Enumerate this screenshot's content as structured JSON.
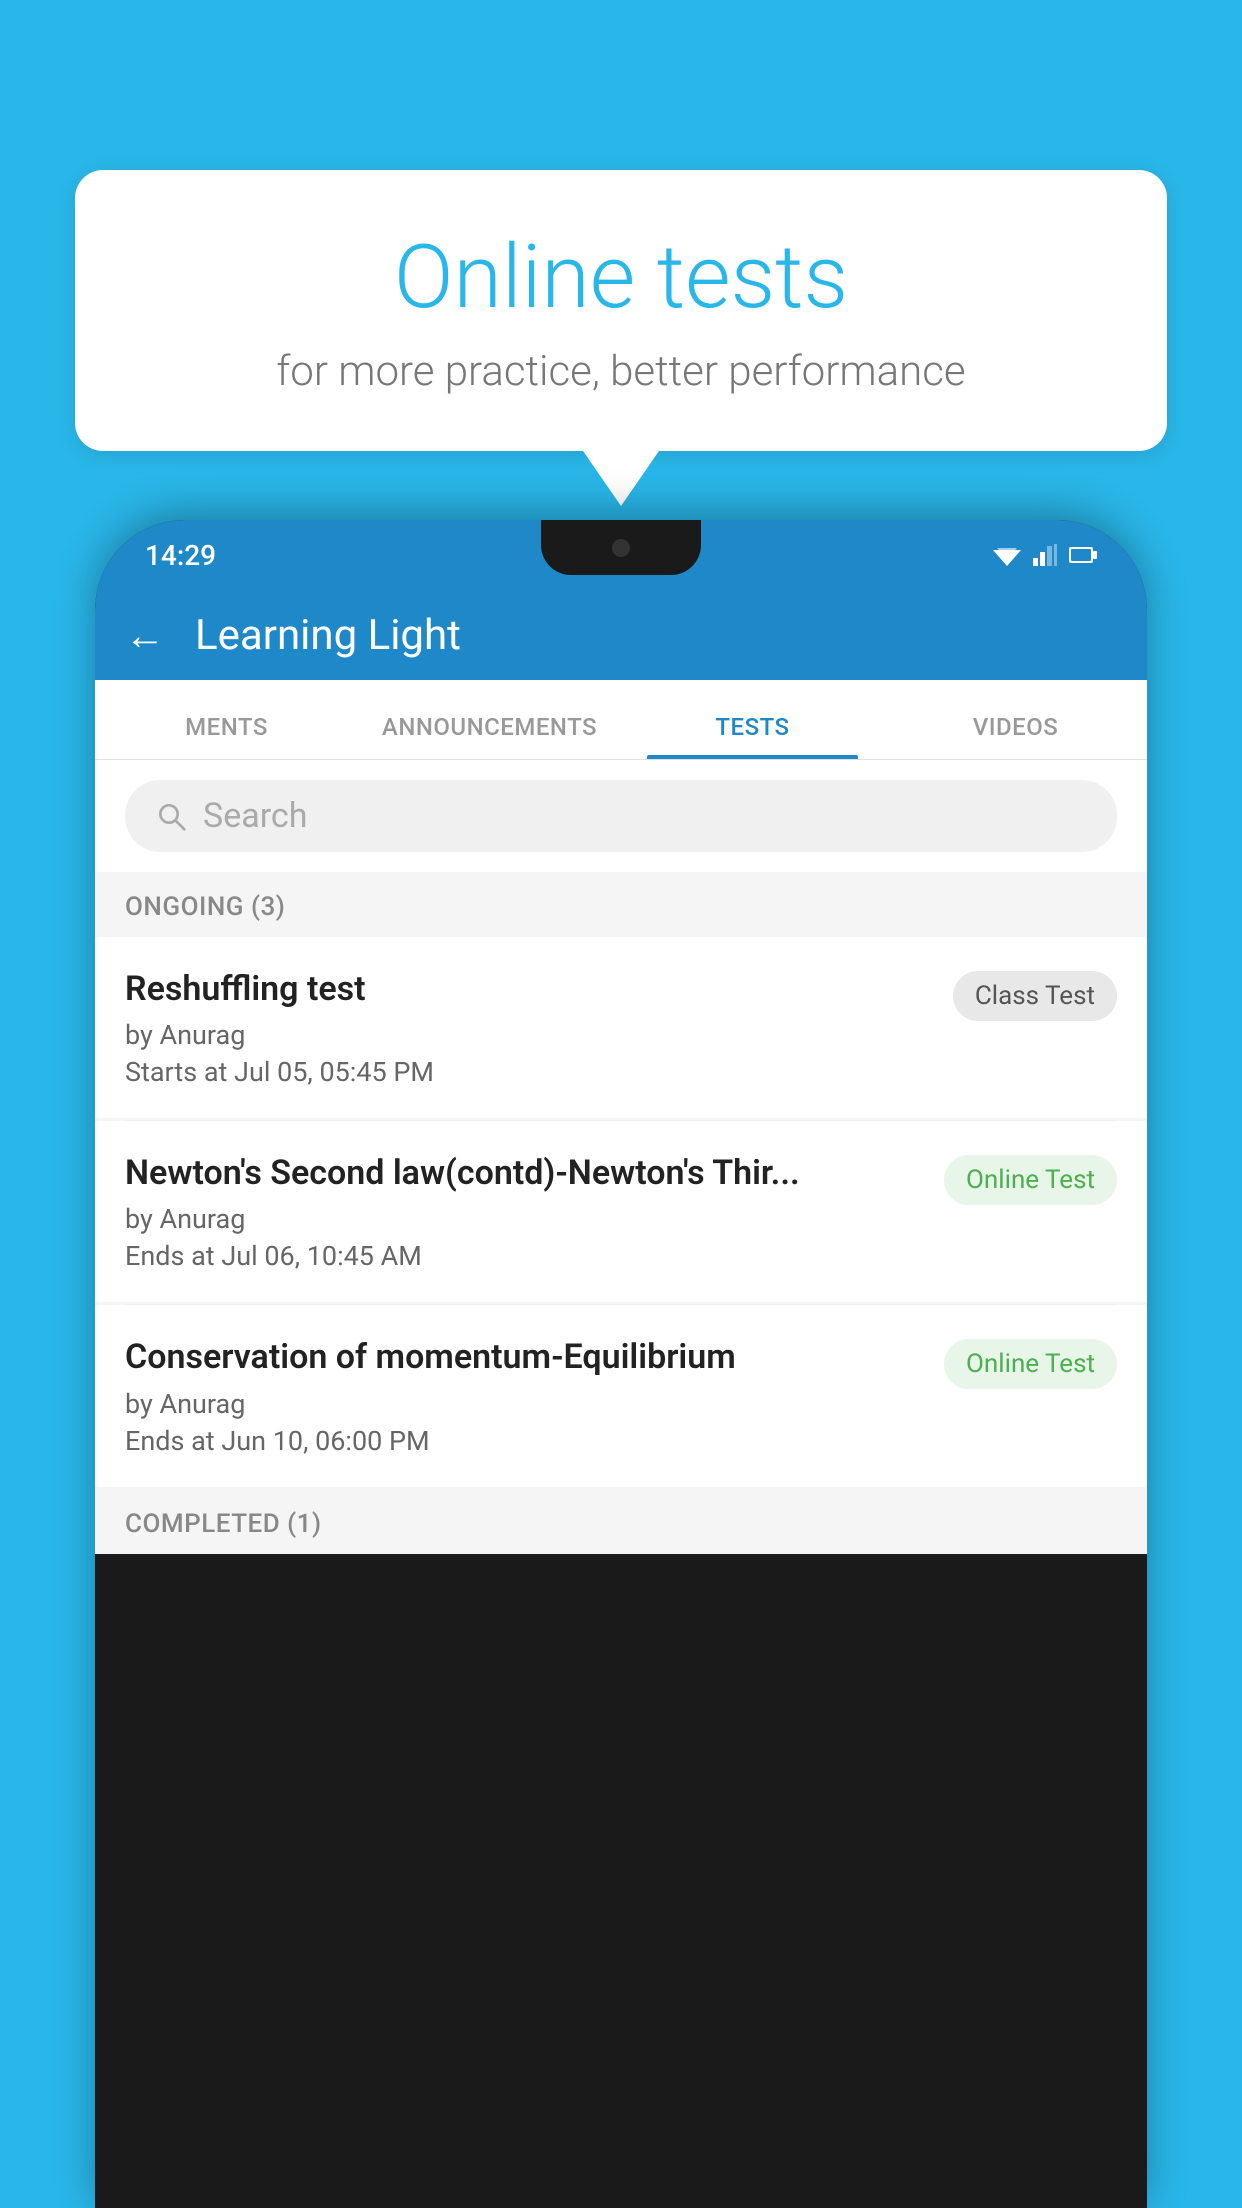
{
  "background": {
    "color": "#29b6e8"
  },
  "speech_bubble": {
    "title": "Online tests",
    "subtitle": "for more practice, better performance"
  },
  "phone": {
    "status_bar": {
      "time": "14:29"
    },
    "header": {
      "title": "Learning Light",
      "back_label": "←"
    },
    "tabs": [
      {
        "label": "MENTS",
        "active": false
      },
      {
        "label": "ANNOUNCEMENTS",
        "active": false
      },
      {
        "label": "TESTS",
        "active": true
      },
      {
        "label": "VIDEOS",
        "active": false
      }
    ],
    "search": {
      "placeholder": "Search"
    },
    "section_ongoing": {
      "label": "ONGOING (3)"
    },
    "tests": [
      {
        "title": "Reshuffling test",
        "author": "by Anurag",
        "date": "Starts at  Jul 05, 05:45 PM",
        "badge": "Class Test",
        "badge_type": "class"
      },
      {
        "title": "Newton's Second law(contd)-Newton's Thir...",
        "author": "by Anurag",
        "date": "Ends at  Jul 06, 10:45 AM",
        "badge": "Online Test",
        "badge_type": "online"
      },
      {
        "title": "Conservation of momentum-Equilibrium",
        "author": "by Anurag",
        "date": "Ends at  Jun 10, 06:00 PM",
        "badge": "Online Test",
        "badge_type": "online"
      }
    ],
    "section_completed": {
      "label": "COMPLETED (1)"
    }
  }
}
